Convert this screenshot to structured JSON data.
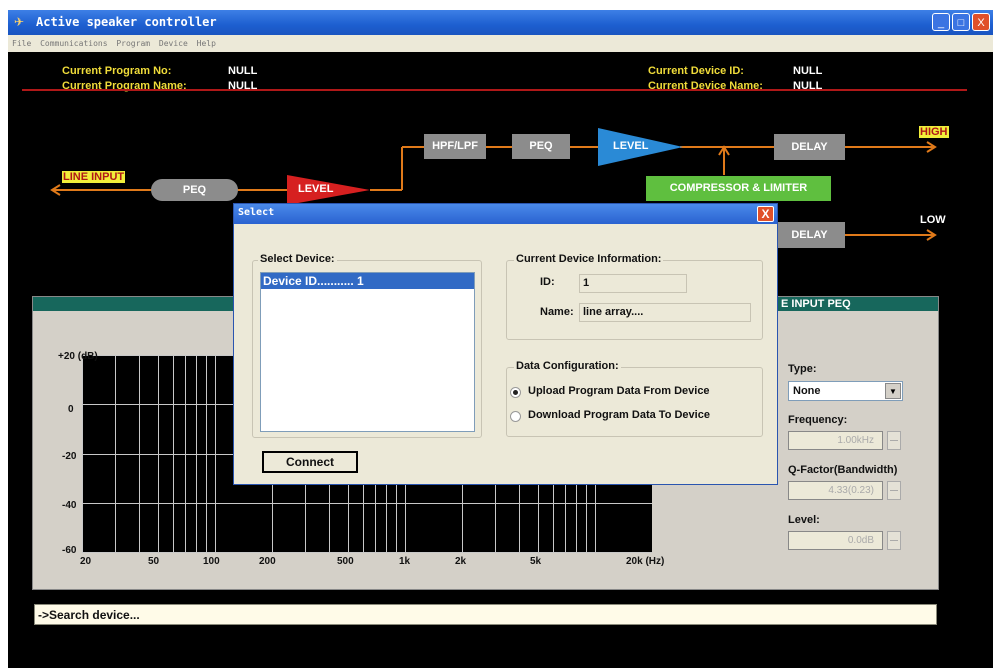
{
  "window": {
    "title": "Active speaker controller",
    "buttons": {
      "minimize": "_",
      "maximize": "□",
      "close": "X"
    }
  },
  "menu": [
    "File",
    "Communications",
    "Program",
    "Device",
    "Help"
  ],
  "header": {
    "program_no_label": "Current Program No:",
    "program_no_value": "NULL",
    "program_name_label": "Current Program Name:",
    "program_name_value": "NULL",
    "device_id_label": "Current Device ID:",
    "device_id_value": "NULL",
    "device_name_label": "Current Device Name:",
    "device_name_value": "NULL"
  },
  "flow": {
    "line_input": "LINE INPUT",
    "peq1": "PEQ",
    "level1": "LEVEL",
    "hpf_lpf": "HPF/LPF",
    "peq2": "PEQ",
    "level2": "LEVEL",
    "delay_high": "DELAY",
    "compressor": "COMPRESSOR & LIMITER",
    "delay_low": "DELAY",
    "high": "HIGH",
    "low": "LOW"
  },
  "peq_panel": {
    "title": "E INPUT PEQ",
    "y_labels": [
      "+20 (dB)",
      "0",
      "-20",
      "-40",
      "-60"
    ],
    "x_labels": [
      "20",
      "50",
      "100",
      "200",
      "500",
      "1k",
      "2k",
      "5k",
      "20k (Hz)"
    ],
    "type_label": "Type:",
    "type_value": "None",
    "frequency_label": "Frequency:",
    "frequency_value": "1.00kHz",
    "q_label": "Q-Factor(Bandwidth)",
    "q_value": "4.33(0.23)",
    "level_label": "Level:",
    "level_value": "0.0dB"
  },
  "status": {
    "text": "->Search device..."
  },
  "dialog": {
    "title": "Select",
    "close": "X",
    "select_device_label": "Select Device:",
    "devices": [
      "Device ID........... 1"
    ],
    "current_info_label": "Current Device Information:",
    "id_label": "ID:",
    "id_value": "1",
    "name_label": "Name:",
    "name_value": "line array....",
    "data_config_label": "Data Configuration:",
    "upload_option": "Upload Program Data From  Device",
    "download_option": "Download Program Data To  Device",
    "connect_label": "Connect"
  },
  "colors": {
    "title_bar": "#2a62d0",
    "header_label": "#f0dc3a",
    "accent_line": "#b01818",
    "flow_line": "#e07a1a",
    "peq_block": "#8c8c8c",
    "level_red": "#d62020",
    "level_blue": "#2a8ad6",
    "compressor_green": "#5fbf3f",
    "panel_bar": "#17675c",
    "selection": "#316ac5"
  }
}
